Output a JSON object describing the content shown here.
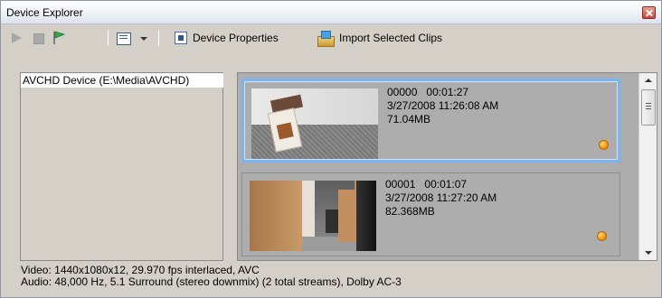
{
  "window": {
    "title": "Device Explorer"
  },
  "toolbar": {
    "device_properties_label": "Device Properties",
    "import_selected_label": "Import Selected Clips"
  },
  "tree": {
    "items": [
      {
        "label": "AVCHD Device (E:\\Media\\AVCHD)",
        "selected": true
      }
    ]
  },
  "clips": [
    {
      "id": "00000",
      "duration": "00:01:27",
      "datetime": "3/27/2008 11:26:08 AM",
      "size": "71.04MB",
      "selected": true,
      "status_color": "#f08a00"
    },
    {
      "id": "00001",
      "duration": "00:01:07",
      "datetime": "3/27/2008 11:27:20 AM",
      "size": "82.368MB",
      "selected": false,
      "status_color": "#f08a00"
    }
  ],
  "info": {
    "video": "Video: 1440x1080x12, 29.970 fps interlaced, AVC",
    "audio": "Audio: 48,000 Hz, 5.1 Surround (stereo downmix) (2 total streams), Dolby AC-3"
  },
  "colors": {
    "selection_border": "#7ab3f3",
    "panel_bg": "#adadad",
    "window_bg": "#d4d0c8"
  }
}
